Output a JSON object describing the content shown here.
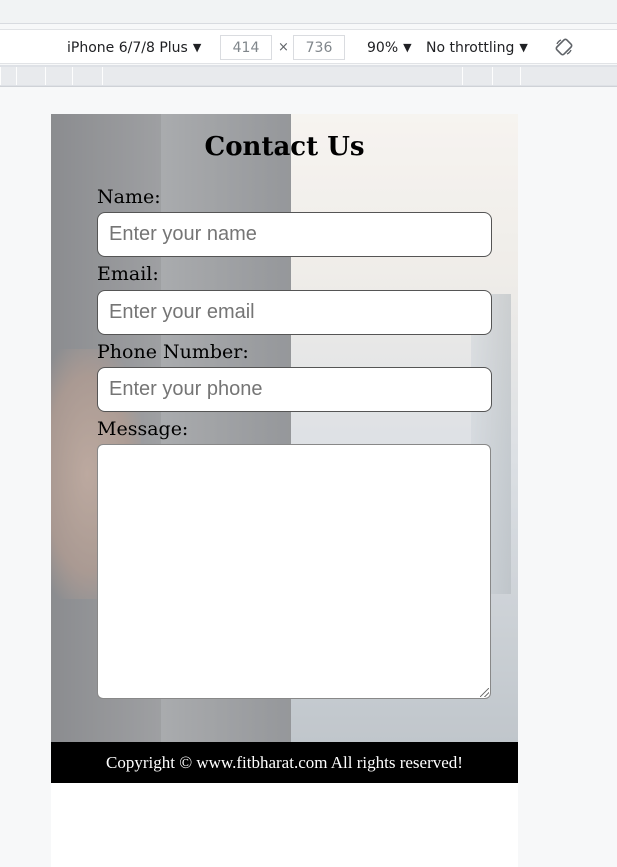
{
  "devtools": {
    "device": "iPhone 6/7/8 Plus",
    "width": "414",
    "height": "736",
    "times": "×",
    "zoom": "90%",
    "throttling": "No throttling",
    "caret": "▼"
  },
  "page": {
    "title": "Contact Us",
    "name_label": "Name:",
    "name_placeholder": "Enter your name",
    "email_label": "Email:",
    "email_placeholder": "Enter your email",
    "phone_label": "Phone Number:",
    "phone_placeholder": "Enter your phone",
    "message_label": "Message:",
    "footer": "Copyright © www.fitbharat.com All rights reserved!"
  }
}
